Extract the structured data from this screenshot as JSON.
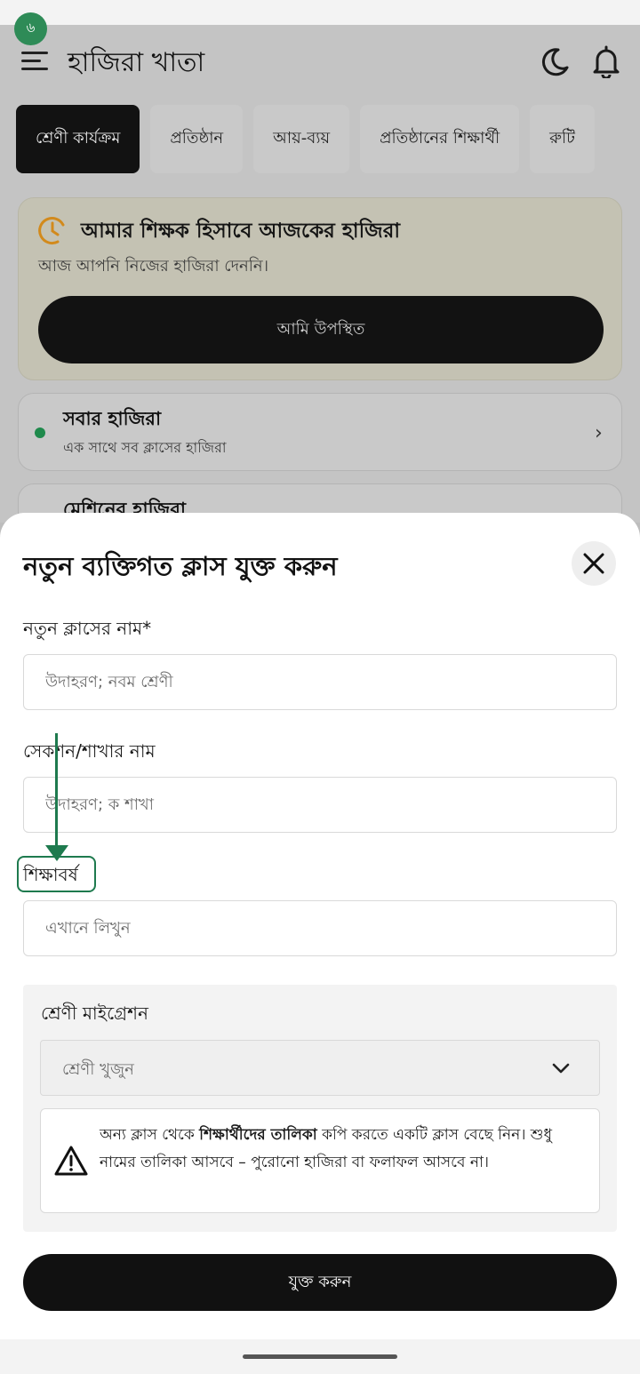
{
  "status": {
    "notification_badge": "৬"
  },
  "app": {
    "title": "হাজিরা খাতা",
    "tabs": [
      "শ্রেণী কার্যক্রম",
      "প্রতিষ্ঠান",
      "আয়-ব্যয়",
      "প্রতিষ্ঠানের শিক্ষার্থী",
      "রুটি"
    ],
    "attendance_card": {
      "title": "আমার শিক্ষক হিসাবে আজকের হাজিরা",
      "subtitle": "আজ আপনি নিজের হাজিরা দেননি।",
      "button": "আমি উপস্থিত"
    },
    "list": [
      {
        "title": "সবার হাজিরা",
        "subtitle": "এক সাথে সব ক্লাসের হাজিরা"
      },
      {
        "title": "মেশিনের হাজিরা"
      }
    ]
  },
  "sheet": {
    "title": "নতুন ব্যক্তিগত ক্লাস যুক্ত করুন",
    "fields": [
      {
        "label": "নতুন ক্লাসের নাম*",
        "placeholder": "উদাহরণ; নবম শ্রেণী"
      },
      {
        "label": "সেকশন/শাখার নাম",
        "placeholder": "উদাহরণ; ক শাখা"
      },
      {
        "label": "শিক্ষাবর্ষ",
        "placeholder": "এখানে লিখুন"
      }
    ],
    "migration": {
      "label": "শ্রেণী মাইগ্রেশন",
      "select_placeholder": "শ্রেণী খুজুন",
      "warning_pre": "অন্য ক্লাস থেকে ",
      "warning_bold": "শিক্ষার্থীদের তালিকা",
      "warning_post": " কপি করতে একটি ক্লাস বেছে নিন। শুধু নামের তালিকা আসবে – পুরোনো হাজিরা বা ফলাফল আসবে না।"
    },
    "submit": "যুক্ত করুন"
  },
  "colors": {
    "accent": "#1e7a4e",
    "primary": "#111111"
  }
}
